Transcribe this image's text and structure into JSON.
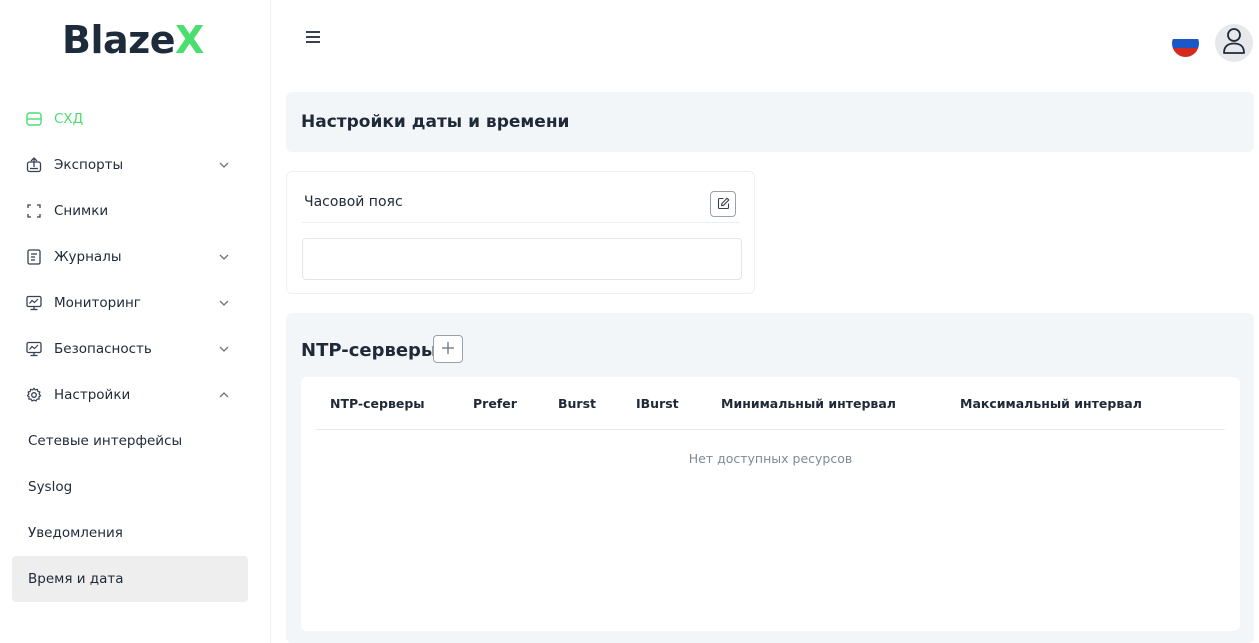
{
  "brand": {
    "name": "Blaze",
    "accent_letter": "X",
    "accent_color": "#4ade6e"
  },
  "sidebar": {
    "items": [
      {
        "label": "СХД",
        "icon": "storage-icon",
        "active": true
      },
      {
        "label": "Экспорты",
        "icon": "export-icon",
        "expandable": true
      },
      {
        "label": "Снимки",
        "icon": "snapshot-icon"
      },
      {
        "label": "Журналы",
        "icon": "journal-icon",
        "expandable": true
      },
      {
        "label": "Мониторинг",
        "icon": "monitor-icon",
        "expandable": true
      },
      {
        "label": "Безопасность",
        "icon": "monitor-icon",
        "expandable": true
      },
      {
        "label": "Настройки",
        "icon": "gear-icon",
        "expanded": true
      }
    ],
    "subitems": [
      {
        "label": "Сетевые интерфейсы"
      },
      {
        "label": "Syslog"
      },
      {
        "label": "Уведомления"
      },
      {
        "label": "Время и дата",
        "selected": true
      }
    ]
  },
  "header": {
    "language": "ru",
    "flag_colors": [
      "#ffffff",
      "#1c57c7",
      "#d52b1e"
    ]
  },
  "page": {
    "title": "Настройки даты и времени"
  },
  "timezone": {
    "label": "Часовой пояс",
    "value": ""
  },
  "ntp": {
    "title": "NTP-серверы",
    "columns": [
      "NTP-серверы",
      "Prefer",
      "Burst",
      "IBurst",
      "Минимальный интервал",
      "Максимальный интервал"
    ],
    "rows": [],
    "empty_text": "Нет доступных ресурсов"
  }
}
